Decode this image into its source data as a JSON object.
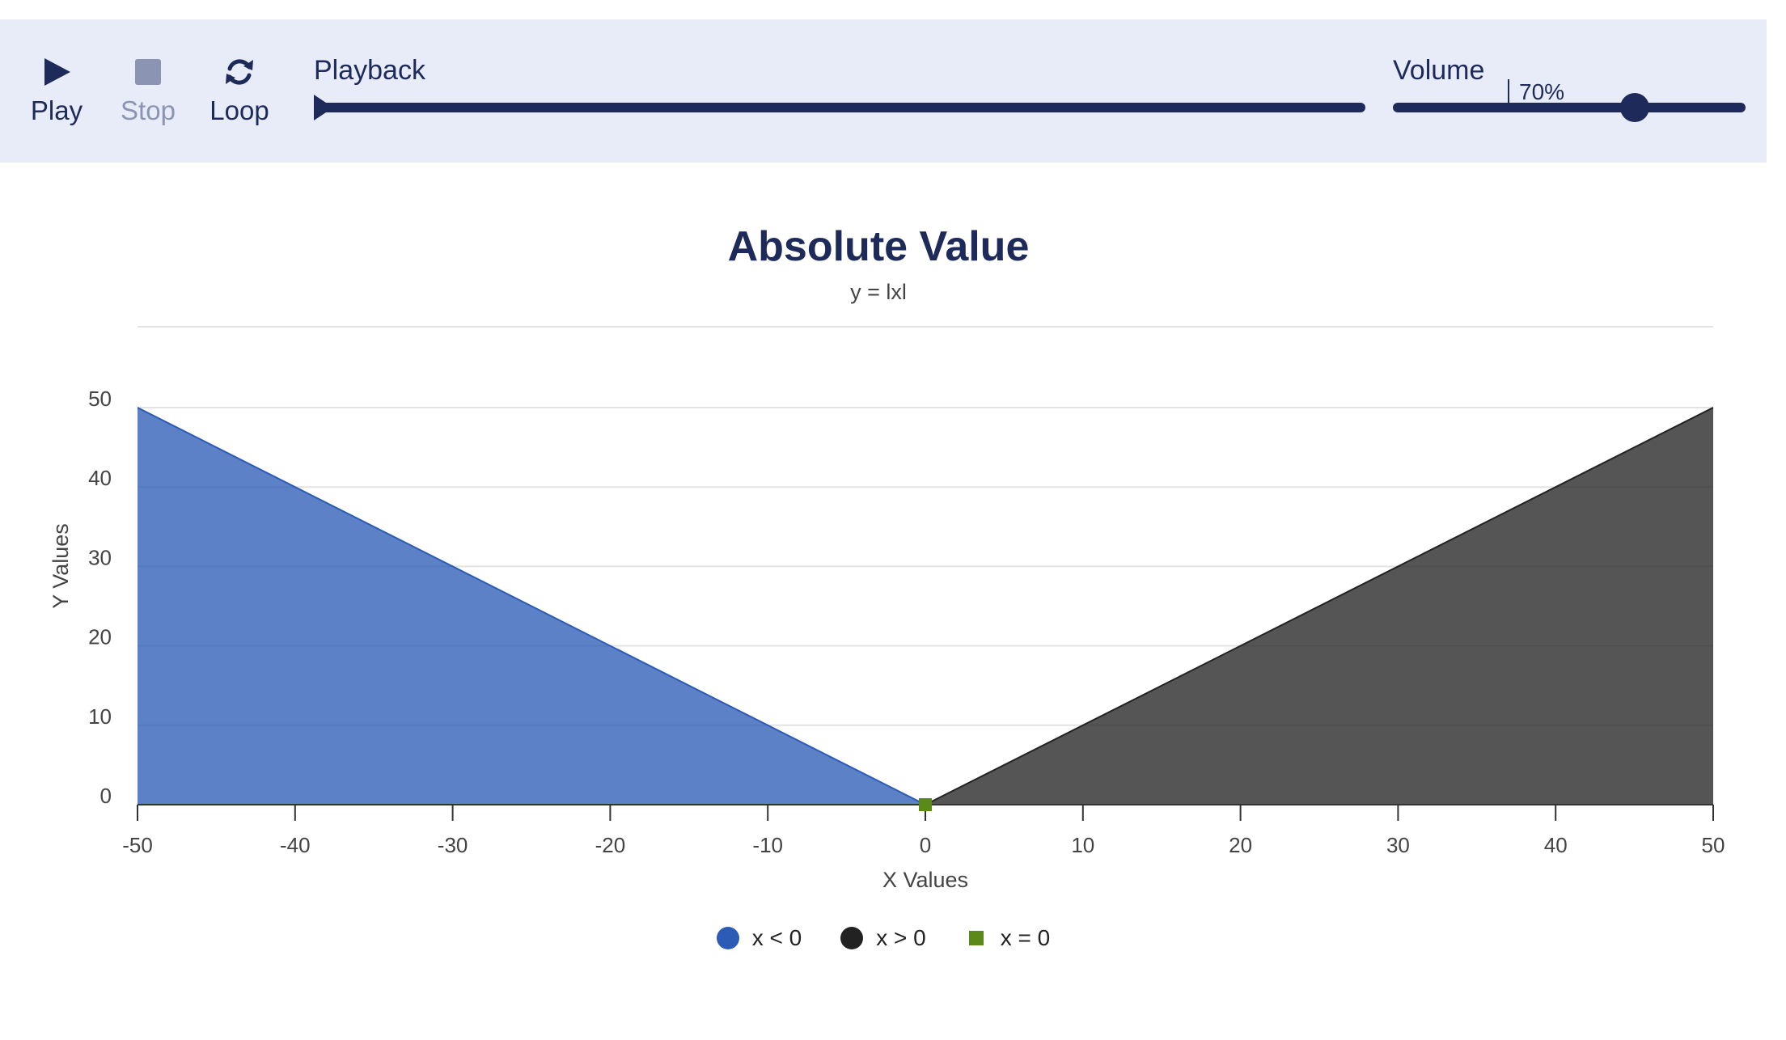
{
  "toolbar": {
    "play_label": "Play",
    "stop_label": "Stop",
    "loop_label": "Loop",
    "playback_label": "Playback",
    "volume_label": "Volume",
    "volume_value": "70%",
    "playback_progress": 0.0,
    "volume_level": 0.7
  },
  "legend": {
    "items": [
      {
        "label": "x < 0",
        "color": "#2b5bb5",
        "shape": "circle"
      },
      {
        "label": "x > 0",
        "color": "#222222",
        "shape": "circle"
      },
      {
        "label": "x = 0",
        "color": "#5b8a1b",
        "shape": "square"
      }
    ]
  },
  "chart_data": {
    "type": "area",
    "title": "Absolute Value",
    "subtitle": "y = lxl",
    "xlabel": "X Values",
    "ylabel": "Y Values",
    "xlim": [
      -50,
      50
    ],
    "ylim": [
      0,
      50
    ],
    "xticks": [
      -50,
      -40,
      -30,
      -20,
      -10,
      0,
      10,
      20,
      30,
      40,
      50
    ],
    "yticks": [
      0,
      10,
      20,
      30,
      40,
      50
    ],
    "grid": true,
    "legend_position": "bottom",
    "series": [
      {
        "name": "x < 0",
        "type": "area",
        "color": "#2b5bb5",
        "points": [
          [
            -50,
            50
          ],
          [
            0,
            0
          ]
        ]
      },
      {
        "name": "x > 0",
        "type": "area",
        "color": "#222222",
        "points": [
          [
            0,
            0
          ],
          [
            50,
            50
          ]
        ]
      },
      {
        "name": "x = 0",
        "type": "scatter",
        "color": "#5b8a1b",
        "points": [
          [
            0,
            0
          ]
        ]
      }
    ]
  }
}
